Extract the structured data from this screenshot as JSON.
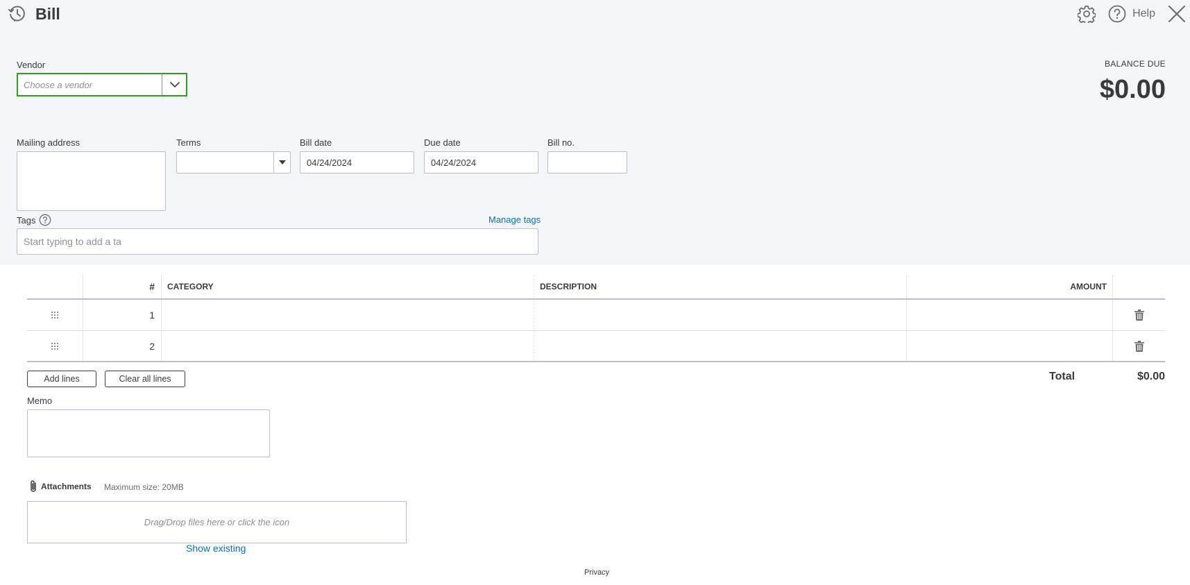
{
  "header": {
    "title": "Bill",
    "help_label": "Help",
    "icons": [
      "recent-transactions-icon",
      "gear-icon",
      "help-icon",
      "close-icon"
    ]
  },
  "vendor": {
    "label": "Vendor",
    "placeholder": "Choose a vendor",
    "value": ""
  },
  "balance": {
    "label": "BALANCE DUE",
    "amount": "$0.00"
  },
  "fields": {
    "mailing_address_label": "Mailing address",
    "mailing_address_value": "",
    "terms_label": "Terms",
    "terms_value": "",
    "bill_date_label": "Bill date",
    "bill_date_value": "04/24/2024",
    "due_date_label": "Due date",
    "due_date_value": "04/24/2024",
    "bill_no_label": "Bill no.",
    "bill_no_value": ""
  },
  "tags": {
    "label": "Tags",
    "manage_label": "Manage tags",
    "placeholder": "Start typing to add a ta"
  },
  "table": {
    "headers": {
      "num": "#",
      "category": "CATEGORY",
      "description": "DESCRIPTION",
      "amount": "AMOUNT"
    },
    "rows": [
      {
        "num": "1",
        "category": "",
        "description": "",
        "amount": ""
      },
      {
        "num": "2",
        "category": "",
        "description": "",
        "amount": ""
      }
    ]
  },
  "actions": {
    "add_lines": "Add lines",
    "clear_all_lines": "Clear all lines"
  },
  "total": {
    "label": "Total",
    "value": "$0.00"
  },
  "memo": {
    "label": "Memo",
    "value": ""
  },
  "attachments": {
    "label": "Attachments",
    "max_size": "Maximum size: 20MB",
    "drop_text": "Drag/Drop files here or click the icon",
    "show_existing": "Show existing"
  },
  "footer": {
    "privacy": "Privacy"
  },
  "colors": {
    "accent_green": "#2ca01c",
    "link_blue": "#0d6fb5",
    "header_bg": "#f4f5f8",
    "text": "#393a3d"
  }
}
